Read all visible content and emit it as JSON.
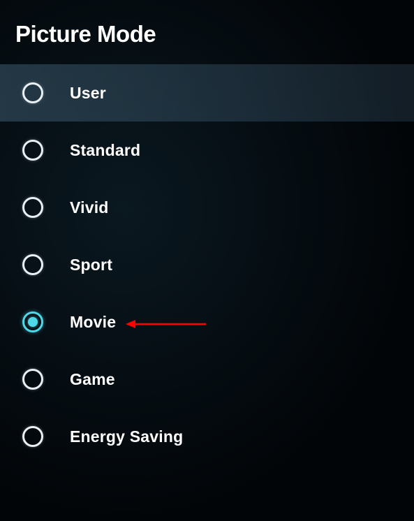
{
  "header": {
    "title": "Picture Mode"
  },
  "menu": {
    "items": [
      {
        "label": "User",
        "selected": false,
        "highlighted": true
      },
      {
        "label": "Standard",
        "selected": false,
        "highlighted": false
      },
      {
        "label": "Vivid",
        "selected": false,
        "highlighted": false
      },
      {
        "label": "Sport",
        "selected": false,
        "highlighted": false
      },
      {
        "label": "Movie",
        "selected": true,
        "highlighted": false
      },
      {
        "label": "Game",
        "selected": false,
        "highlighted": false
      },
      {
        "label": "Energy Saving",
        "selected": false,
        "highlighted": false
      }
    ]
  },
  "colors": {
    "accent": "#4fd8e8",
    "text": "#ffffff",
    "annotation_arrow": "#ff0000"
  }
}
